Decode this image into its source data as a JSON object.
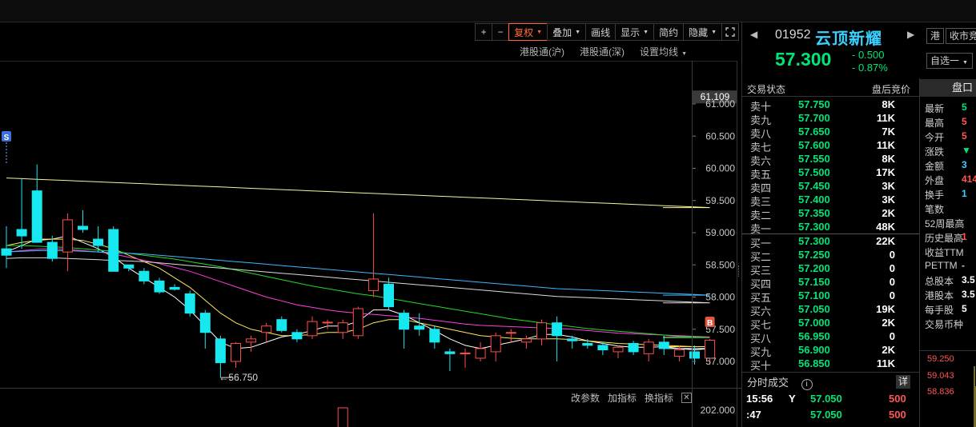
{
  "toolbar": {
    "buttons": [
      {
        "label": "+",
        "square": true
      },
      {
        "label": "−",
        "square": true
      },
      {
        "label": "复权",
        "caret": true,
        "active": true
      },
      {
        "label": "叠加",
        "caret": true
      },
      {
        "label": "画线"
      },
      {
        "label": "显示",
        "caret": true
      },
      {
        "label": "简约"
      },
      {
        "label": "隐藏",
        "caret": true
      }
    ],
    "fullscreen_icon": "expand-icon"
  },
  "subbar": {
    "sh_connect": "港股通(沪)",
    "sz_connect": "港股通(深)",
    "ma_settings": "设置均线"
  },
  "price_axis": {
    "current": "61.109",
    "labels": [
      "61.000",
      "60.500",
      "60.000",
      "59.500",
      "59.000",
      "58.500",
      "58.000",
      "57.500",
      "57.000"
    ],
    "vol_label": "202.000"
  },
  "markers": {
    "sell": "S",
    "buy": "B",
    "low_label": "56.750"
  },
  "volume_bar": {
    "edit_params": "改参数",
    "add_indicator": "加指标",
    "switch_indicator": "换指标"
  },
  "quote": {
    "code": "01952",
    "name": "云顶新耀",
    "price": "57.300",
    "change": "- 0.500",
    "change_pct": "- 0.87%",
    "market_tag": "港",
    "auction_tag": "收市竞",
    "watchlist_tag": "自选一",
    "status_label": "交易状态",
    "status_value": "盘后竞价",
    "panel_tab": "盘口"
  },
  "order_book": {
    "asks": [
      {
        "label": "卖十",
        "price": "57.750",
        "vol": "8K"
      },
      {
        "label": "卖九",
        "price": "57.700",
        "vol": "11K"
      },
      {
        "label": "卖八",
        "price": "57.650",
        "vol": "7K"
      },
      {
        "label": "卖七",
        "price": "57.600",
        "vol": "11K"
      },
      {
        "label": "卖六",
        "price": "57.550",
        "vol": "8K"
      },
      {
        "label": "卖五",
        "price": "57.500",
        "vol": "17K"
      },
      {
        "label": "卖四",
        "price": "57.450",
        "vol": "3K"
      },
      {
        "label": "卖三",
        "price": "57.400",
        "vol": "3K"
      },
      {
        "label": "卖二",
        "price": "57.350",
        "vol": "2K"
      },
      {
        "label": "卖一",
        "price": "57.300",
        "vol": "48K"
      }
    ],
    "bids": [
      {
        "label": "买一",
        "price": "57.300",
        "vol": "22K"
      },
      {
        "label": "买二",
        "price": "57.250",
        "vol": "0"
      },
      {
        "label": "买三",
        "price": "57.200",
        "vol": "0"
      },
      {
        "label": "买四",
        "price": "57.150",
        "vol": "0"
      },
      {
        "label": "买五",
        "price": "57.100",
        "vol": "0"
      },
      {
        "label": "买六",
        "price": "57.050",
        "vol": "19K"
      },
      {
        "label": "买七",
        "price": "57.000",
        "vol": "2K"
      },
      {
        "label": "买八",
        "price": "56.950",
        "vol": "0"
      },
      {
        "label": "买九",
        "price": "56.900",
        "vol": "2K"
      },
      {
        "label": "买十",
        "price": "56.850",
        "vol": "11K"
      }
    ]
  },
  "stats": [
    {
      "label": "最新",
      "value": "5",
      "color": "#00e676"
    },
    {
      "label": "最高",
      "value": "5",
      "color": "#ff5555"
    },
    {
      "label": "今开",
      "value": "5",
      "color": "#ff5555"
    },
    {
      "label": "涨跌",
      "value": "▼",
      "color": "#00e676"
    },
    {
      "label": "金额",
      "value": "3",
      "color": "#3ad1ff"
    },
    {
      "label": "外盘",
      "value": "414",
      "color": "#ff5555"
    },
    {
      "label": "换手",
      "value": "1",
      "color": "#3ad1ff"
    },
    {
      "label": "笔数",
      "value": "",
      "color": "#cfcfcf"
    },
    {
      "label": "52周最高",
      "value": "",
      "color": "#cfcfcf"
    },
    {
      "label": "历史最高",
      "value": "1",
      "color": "#ff5555"
    },
    {
      "label": "收益TTM",
      "value": "",
      "color": "#cfcfcf"
    },
    {
      "label": "PETTM",
      "value": "-",
      "color": "#cfcfcf"
    },
    {
      "label": "总股本",
      "value": "3.5",
      "color": "#ffffff"
    },
    {
      "label": "港股本",
      "value": "3.5",
      "color": "#ffffff"
    },
    {
      "label": "每手股",
      "value": "5",
      "color": "#ffffff"
    },
    {
      "label": "交易币种",
      "value": "",
      "color": "#cfcfcf"
    }
  ],
  "mini_chart": {
    "labels": [
      "59.250",
      "59.043",
      "58.836"
    ]
  },
  "time_sales": {
    "title": "分时成交",
    "detail_label": "详",
    "rows": [
      {
        "time": "15:56",
        "flag": "Y",
        "price": "57.050",
        "vol": "500"
      },
      {
        "time": ":47",
        "flag": "",
        "price": "57.050",
        "vol": "500"
      }
    ]
  },
  "chart_data": {
    "type": "candlestick",
    "ylim": [
      56.6,
      61.2
    ],
    "candles": [
      {
        "o": 58.75,
        "h": 59.1,
        "l": 58.45,
        "c": 58.65
      },
      {
        "o": 59.05,
        "h": 59.85,
        "l": 58.75,
        "c": 58.95
      },
      {
        "o": 59.65,
        "h": 60.06,
        "l": 58.9,
        "c": 58.85
      },
      {
        "o": 58.85,
        "h": 58.95,
        "l": 58.55,
        "c": 58.6
      },
      {
        "o": 58.7,
        "h": 59.3,
        "l": 58.4,
        "c": 59.2
      },
      {
        "o": 59.1,
        "h": 59.35,
        "l": 59.0,
        "c": 59.05
      },
      {
        "o": 58.9,
        "h": 59.1,
        "l": 58.7,
        "c": 58.8
      },
      {
        "o": 59.05,
        "h": 59.1,
        "l": 58.4,
        "c": 58.4
      },
      {
        "o": 58.5,
        "h": 58.5,
        "l": 58.4,
        "c": 58.45
      },
      {
        "o": 58.4,
        "h": 58.45,
        "l": 58.2,
        "c": 58.25
      },
      {
        "o": 58.25,
        "h": 58.3,
        "l": 58.05,
        "c": 58.08
      },
      {
        "o": 58.15,
        "h": 58.2,
        "l": 58.1,
        "c": 58.12
      },
      {
        "o": 58.05,
        "h": 58.1,
        "l": 57.7,
        "c": 57.75
      },
      {
        "o": 57.75,
        "h": 57.8,
        "l": 57.2,
        "c": 57.45
      },
      {
        "o": 57.35,
        "h": 57.4,
        "l": 56.75,
        "c": 56.98
      },
      {
        "o": 57.0,
        "h": 57.3,
        "l": 56.9,
        "c": 57.28
      },
      {
        "o": 57.3,
        "h": 57.4,
        "l": 57.15,
        "c": 57.35
      },
      {
        "o": 57.45,
        "h": 57.6,
        "l": 57.3,
        "c": 57.55
      },
      {
        "o": 57.65,
        "h": 57.7,
        "l": 57.45,
        "c": 57.48
      },
      {
        "o": 57.45,
        "h": 57.5,
        "l": 57.3,
        "c": 57.35
      },
      {
        "o": 57.4,
        "h": 57.7,
        "l": 57.35,
        "c": 57.62
      },
      {
        "o": 57.6,
        "h": 57.65,
        "l": 57.5,
        "c": 57.61
      },
      {
        "o": 57.45,
        "h": 57.65,
        "l": 57.35,
        "c": 57.6
      },
      {
        "o": 57.4,
        "h": 57.85,
        "l": 57.35,
        "c": 57.82
      },
      {
        "o": 58.1,
        "h": 59.3,
        "l": 58.0,
        "c": 58.28
      },
      {
        "o": 58.2,
        "h": 58.3,
        "l": 57.8,
        "c": 57.85
      },
      {
        "o": 57.75,
        "h": 57.8,
        "l": 57.2,
        "c": 57.5
      },
      {
        "o": 57.55,
        "h": 57.75,
        "l": 57.4,
        "c": 57.5
      },
      {
        "o": 57.5,
        "h": 57.55,
        "l": 57.2,
        "c": 57.3
      },
      {
        "o": 57.15,
        "h": 57.2,
        "l": 56.85,
        "c": 57.12
      },
      {
        "o": 57.12,
        "h": 57.2,
        "l": 56.9,
        "c": 57.13
      },
      {
        "o": 57.05,
        "h": 57.3,
        "l": 57.0,
        "c": 57.2
      },
      {
        "o": 57.15,
        "h": 57.45,
        "l": 57.0,
        "c": 57.4
      },
      {
        "o": 57.45,
        "h": 57.5,
        "l": 57.3,
        "c": 57.45
      },
      {
        "o": 57.3,
        "h": 57.4,
        "l": 57.2,
        "c": 57.35
      },
      {
        "o": 57.35,
        "h": 57.65,
        "l": 57.25,
        "c": 57.6
      },
      {
        "o": 57.6,
        "h": 57.7,
        "l": 57.0,
        "c": 57.4
      },
      {
        "o": 57.35,
        "h": 57.4,
        "l": 57.2,
        "c": 57.32
      },
      {
        "o": 57.28,
        "h": 57.35,
        "l": 57.2,
        "c": 57.25
      },
      {
        "o": 57.25,
        "h": 57.3,
        "l": 57.1,
        "c": 57.18
      },
      {
        "o": 57.15,
        "h": 57.25,
        "l": 57.05,
        "c": 57.22
      },
      {
        "o": 57.28,
        "h": 57.32,
        "l": 57.1,
        "c": 57.15
      },
      {
        "o": 57.12,
        "h": 57.35,
        "l": 57.0,
        "c": 57.3
      },
      {
        "o": 57.3,
        "h": 57.4,
        "l": 57.1,
        "c": 57.2
      },
      {
        "o": 57.08,
        "h": 57.25,
        "l": 57.0,
        "c": 57.18
      },
      {
        "o": 57.15,
        "h": 57.25,
        "l": 56.95,
        "c": 57.05
      },
      {
        "o": 57.05,
        "h": 57.35,
        "l": 56.95,
        "c": 57.33
      }
    ],
    "ma": [
      {
        "name": "MA5",
        "color": "#ffffff",
        "values": [
          58.7,
          58.8,
          58.9,
          58.9,
          58.95,
          58.85,
          58.75,
          58.62,
          58.45,
          58.3,
          58.15,
          58.0,
          57.8,
          57.55,
          57.3,
          57.2,
          57.22,
          57.3,
          57.38,
          57.42,
          57.48,
          57.55,
          57.55,
          57.62,
          57.8,
          57.8,
          57.72,
          57.6,
          57.48,
          57.35,
          57.25,
          57.2,
          57.25,
          57.3,
          57.35,
          57.42,
          57.42,
          57.38,
          57.32,
          57.28,
          57.24,
          57.22,
          57.22,
          57.23,
          57.2,
          57.18,
          57.2
        ]
      },
      {
        "name": "MA10",
        "color": "#ffe95a",
        "values": [
          58.8,
          58.85,
          58.88,
          58.9,
          58.9,
          58.88,
          58.82,
          58.75,
          58.65,
          58.55,
          58.45,
          58.3,
          58.15,
          57.95,
          57.75,
          57.6,
          57.5,
          57.45,
          57.4,
          57.4,
          57.42,
          57.45,
          57.45,
          57.5,
          57.6,
          57.65,
          57.65,
          57.6,
          57.55,
          57.5,
          57.45,
          57.4,
          57.38,
          57.36,
          57.35,
          57.35,
          57.35,
          57.34,
          57.32,
          57.3,
          57.28,
          57.27,
          57.26,
          57.25,
          57.24,
          57.23,
          57.23
        ]
      },
      {
        "name": "MA20",
        "color": "#ff3fe0",
        "values": [
          58.7,
          58.72,
          58.74,
          58.75,
          58.74,
          58.72,
          58.7,
          58.67,
          58.62,
          58.57,
          58.52,
          58.46,
          58.4,
          58.32,
          58.24,
          58.16,
          58.08,
          58.0,
          57.94,
          57.88,
          57.84,
          57.8,
          57.77,
          57.75,
          57.73,
          57.71,
          57.69,
          57.67,
          57.64,
          57.61,
          57.58,
          57.56,
          57.55,
          57.54,
          57.53,
          57.52,
          57.51,
          57.5,
          57.48,
          57.46,
          57.44,
          57.43,
          57.42,
          57.41,
          57.4,
          57.39,
          57.38
        ]
      },
      {
        "name": "MA30",
        "color": "#22dd22",
        "values": [
          58.8,
          58.8,
          58.79,
          58.78,
          58.77,
          58.75,
          58.73,
          58.71,
          58.68,
          58.65,
          58.62,
          58.59,
          58.55,
          58.51,
          58.47,
          58.42,
          58.37,
          58.32,
          58.27,
          58.22,
          58.17,
          58.13,
          58.09,
          58.05,
          58.02,
          57.98,
          57.94,
          57.9,
          57.86,
          57.82,
          57.78,
          57.74,
          57.7,
          57.66,
          57.63,
          57.6,
          57.57,
          57.54,
          57.51,
          57.49,
          57.47,
          57.45,
          57.43,
          57.41,
          57.39,
          57.38,
          57.37
        ]
      },
      {
        "name": "MA60",
        "color": "#3fb6ff",
        "values": [
          58.7,
          58.71,
          58.72,
          58.72,
          58.72,
          58.71,
          58.7,
          58.69,
          58.68,
          58.67,
          58.65,
          58.63,
          58.61,
          58.59,
          58.57,
          58.55,
          58.53,
          58.51,
          58.49,
          58.47,
          58.45,
          58.43,
          58.41,
          58.39,
          58.37,
          58.35,
          58.33,
          58.31,
          58.29,
          58.27,
          58.25,
          58.23,
          58.21,
          58.19,
          58.17,
          58.15,
          58.13,
          58.12,
          58.11,
          58.1,
          58.09,
          58.08,
          58.07,
          58.06,
          58.05,
          58.04,
          58.03
        ]
      },
      {
        "name": "MA120",
        "color": "#dddddd",
        "values": [
          58.6,
          58.61,
          58.61,
          58.61,
          58.6,
          58.59,
          58.58,
          58.57,
          58.56,
          58.55,
          58.53,
          58.51,
          58.49,
          58.47,
          58.45,
          58.43,
          58.41,
          58.39,
          58.37,
          58.35,
          58.33,
          58.31,
          58.29,
          58.27,
          58.25,
          58.23,
          58.21,
          58.19,
          58.17,
          58.15,
          58.13,
          58.11,
          58.09,
          58.07,
          58.05,
          58.03,
          58.01,
          58.0,
          57.99,
          57.98,
          57.97,
          57.96,
          57.95,
          57.94,
          57.93,
          57.92,
          57.91
        ]
      },
      {
        "name": "MA250",
        "color": "#f5f5a0",
        "values": [
          59.85,
          59.84,
          59.83,
          59.82,
          59.81,
          59.8,
          59.79,
          59.78,
          59.77,
          59.76,
          59.75,
          59.74,
          59.73,
          59.72,
          59.71,
          59.7,
          59.69,
          59.68,
          59.67,
          59.66,
          59.65,
          59.64,
          59.63,
          59.62,
          59.61,
          59.6,
          59.59,
          59.58,
          59.57,
          59.56,
          59.55,
          59.54,
          59.53,
          59.52,
          59.51,
          59.5,
          59.49,
          59.48,
          59.47,
          59.46,
          59.45,
          59.44,
          59.43,
          59.42,
          59.41,
          59.4,
          59.39
        ]
      }
    ],
    "volume_bars": [
      {
        "index": 22,
        "ratio": 1.0
      }
    ]
  }
}
